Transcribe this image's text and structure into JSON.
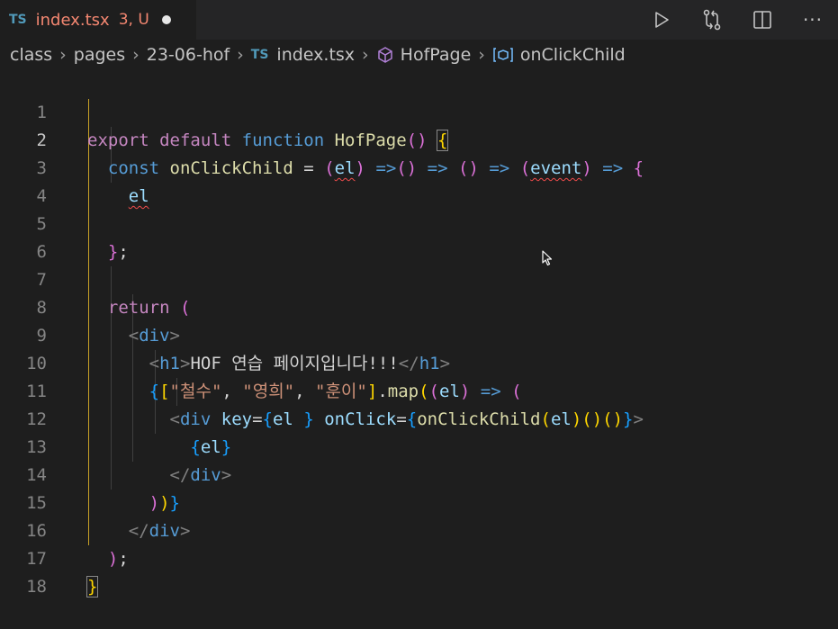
{
  "tab": {
    "lang": "TS",
    "filename": "index.tsx",
    "problems": "3, U"
  },
  "actions": [
    "run-icon",
    "compare-changes-icon",
    "split-editor-icon",
    "more-actions-icon"
  ],
  "actions_more": "···",
  "breadcrumb": {
    "items": [
      "class",
      "pages",
      "23-06-hof",
      "index.tsx",
      "HofPage",
      "onClickChild"
    ],
    "ts_label": "TS"
  },
  "editor": {
    "line_numbers": [
      "1",
      "2",
      "3",
      "4",
      "5",
      "6",
      "7",
      "8",
      "9",
      "10",
      "11",
      "12",
      "13",
      "14",
      "15",
      "16",
      "17",
      "18"
    ],
    "active_line": "2"
  },
  "colors": {
    "background": "#1e1e1e",
    "tab_modified": "#f48771",
    "keyword": "#c586c0",
    "storage": "#569cd6",
    "function": "#dcdcaa",
    "variable": "#9cdcfe",
    "string": "#ce9178",
    "error_squiggle": "#f14c4c",
    "indent_guide_active": "#c9a227"
  }
}
